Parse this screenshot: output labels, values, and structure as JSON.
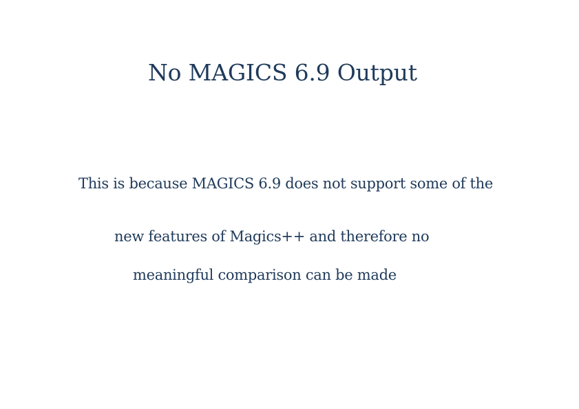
{
  "page": {
    "title": "No MAGICS 6.9 Output",
    "message_lines": [
      "This is because MAGICS 6.9 does not support some of the",
      "new features of Magics++ and therefore no",
      "meaningful comparison can be made"
    ],
    "text_color": "#1f3a5a",
    "background_color": "#ffffff"
  }
}
